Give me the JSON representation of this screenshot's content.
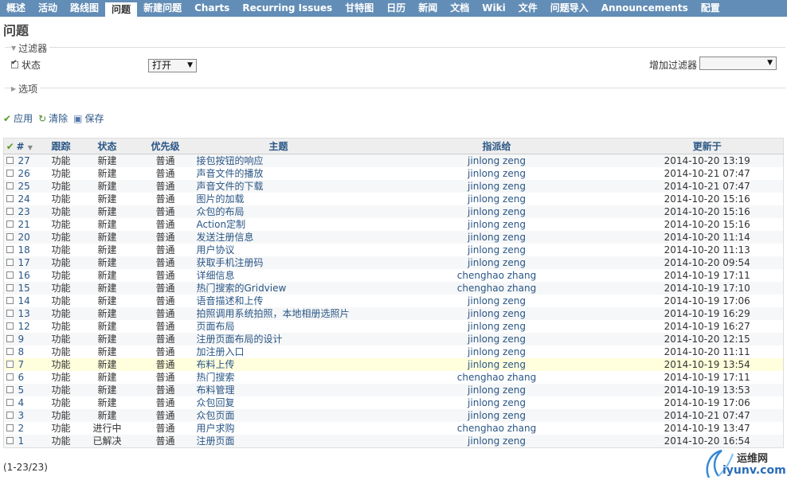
{
  "topmenu": {
    "tabs": [
      {
        "label": "概述",
        "selected": false
      },
      {
        "label": "活动",
        "selected": false
      },
      {
        "label": "路线图",
        "selected": false
      },
      {
        "label": "问题",
        "selected": true
      },
      {
        "label": "新建问题",
        "selected": false
      },
      {
        "label": "Charts",
        "selected": false
      },
      {
        "label": "Recurring Issues",
        "selected": false
      },
      {
        "label": "甘特图",
        "selected": false
      },
      {
        "label": "日历",
        "selected": false
      },
      {
        "label": "新闻",
        "selected": false
      },
      {
        "label": "文档",
        "selected": false
      },
      {
        "label": "Wiki",
        "selected": false
      },
      {
        "label": "文件",
        "selected": false
      },
      {
        "label": "问题导入",
        "selected": false
      },
      {
        "label": "Announcements",
        "selected": false
      },
      {
        "label": "配置",
        "selected": false
      }
    ]
  },
  "page": {
    "title": "问题"
  },
  "filters": {
    "legend": "过滤器",
    "status_label": "状态",
    "status_value": "打开",
    "add_filter_label": "增加过滤器",
    "add_filter_value": ""
  },
  "options": {
    "legend": "选项"
  },
  "actions": {
    "apply": "应用",
    "clear": "清除",
    "save": "保存"
  },
  "table": {
    "headers": {
      "id": "#",
      "tracker": "跟踪",
      "status": "状态",
      "priority": "优先级",
      "subject": "主题",
      "assignee": "指派给",
      "updated": "更新于"
    },
    "rows": [
      {
        "id": "27",
        "tracker": "功能",
        "status": "新建",
        "priority": "普通",
        "subject": "接包按钮的响应",
        "assignee": "jinlong zeng",
        "updated": "2014-10-20 13:19"
      },
      {
        "id": "26",
        "tracker": "功能",
        "status": "新建",
        "priority": "普通",
        "subject": "声音文件的播放",
        "assignee": "jinlong zeng",
        "updated": "2014-10-21 07:47"
      },
      {
        "id": "25",
        "tracker": "功能",
        "status": "新建",
        "priority": "普通",
        "subject": "声音文件的下载",
        "assignee": "jinlong zeng",
        "updated": "2014-10-21 07:47"
      },
      {
        "id": "24",
        "tracker": "功能",
        "status": "新建",
        "priority": "普通",
        "subject": "图片的加载",
        "assignee": "jinlong zeng",
        "updated": "2014-10-20 15:16"
      },
      {
        "id": "23",
        "tracker": "功能",
        "status": "新建",
        "priority": "普通",
        "subject": "众包的布局",
        "assignee": "jinlong zeng",
        "updated": "2014-10-20 15:16"
      },
      {
        "id": "21",
        "tracker": "功能",
        "status": "新建",
        "priority": "普通",
        "subject": "Action定制",
        "assignee": "jinlong zeng",
        "updated": "2014-10-20 15:16"
      },
      {
        "id": "20",
        "tracker": "功能",
        "status": "新建",
        "priority": "普通",
        "subject": "发送注册信息",
        "assignee": "jinlong zeng",
        "updated": "2014-10-20 11:14"
      },
      {
        "id": "18",
        "tracker": "功能",
        "status": "新建",
        "priority": "普通",
        "subject": "用户协议",
        "assignee": "jinlong zeng",
        "updated": "2014-10-20 11:13"
      },
      {
        "id": "17",
        "tracker": "功能",
        "status": "新建",
        "priority": "普通",
        "subject": "获取手机注册码",
        "assignee": "jinlong zeng",
        "updated": "2014-10-20 09:54"
      },
      {
        "id": "16",
        "tracker": "功能",
        "status": "新建",
        "priority": "普通",
        "subject": "详细信息",
        "assignee": "chenghao zhang",
        "updated": "2014-10-19 17:11"
      },
      {
        "id": "15",
        "tracker": "功能",
        "status": "新建",
        "priority": "普通",
        "subject": "热门搜索的Gridview",
        "assignee": "chenghao zhang",
        "updated": "2014-10-19 17:10"
      },
      {
        "id": "14",
        "tracker": "功能",
        "status": "新建",
        "priority": "普通",
        "subject": "语音描述和上传",
        "assignee": "jinlong zeng",
        "updated": "2014-10-19 17:06"
      },
      {
        "id": "13",
        "tracker": "功能",
        "status": "新建",
        "priority": "普通",
        "subject": "拍照调用系统拍照，本地相册选照片",
        "assignee": "jinlong zeng",
        "updated": "2014-10-19 16:29"
      },
      {
        "id": "12",
        "tracker": "功能",
        "status": "新建",
        "priority": "普通",
        "subject": "页面布局",
        "assignee": "jinlong zeng",
        "updated": "2014-10-19 16:27"
      },
      {
        "id": "9",
        "tracker": "功能",
        "status": "新建",
        "priority": "普通",
        "subject": "注册页面布局的设计",
        "assignee": "jinlong zeng",
        "updated": "2014-10-20 12:15"
      },
      {
        "id": "8",
        "tracker": "功能",
        "status": "新建",
        "priority": "普通",
        "subject": "加注册入口",
        "assignee": "jinlong zeng",
        "updated": "2014-10-20 11:11"
      },
      {
        "id": "7",
        "tracker": "功能",
        "status": "新建",
        "priority": "普通",
        "subject": "布料上传",
        "assignee": "jinlong zeng",
        "updated": "2014-10-19 13:54"
      },
      {
        "id": "6",
        "tracker": "功能",
        "status": "新建",
        "priority": "普通",
        "subject": "热门搜索",
        "assignee": "chenghao zhang",
        "updated": "2014-10-19 17:11"
      },
      {
        "id": "5",
        "tracker": "功能",
        "status": "新建",
        "priority": "普通",
        "subject": "布料管理",
        "assignee": "jinlong zeng",
        "updated": "2014-10-19 13:53"
      },
      {
        "id": "4",
        "tracker": "功能",
        "status": "新建",
        "priority": "普通",
        "subject": "众包回复",
        "assignee": "jinlong zeng",
        "updated": "2014-10-19 17:06"
      },
      {
        "id": "3",
        "tracker": "功能",
        "status": "新建",
        "priority": "普通",
        "subject": "众包页面",
        "assignee": "jinlong zeng",
        "updated": "2014-10-21 07:47"
      },
      {
        "id": "2",
        "tracker": "功能",
        "status": "进行中",
        "priority": "普通",
        "subject": "用户求购",
        "assignee": "chenghao zhang",
        "updated": "2014-10-19 13:47"
      },
      {
        "id": "1",
        "tracker": "功能",
        "status": "已解决",
        "priority": "普通",
        "subject": "注册页面",
        "assignee": "jinlong zeng",
        "updated": "2014-10-20 16:54"
      }
    ],
    "highlighted_id": "7"
  },
  "pagination": {
    "count": "(1-23/23)"
  },
  "watermark": {
    "cn": "运维网",
    "en": "iyunv.com"
  }
}
